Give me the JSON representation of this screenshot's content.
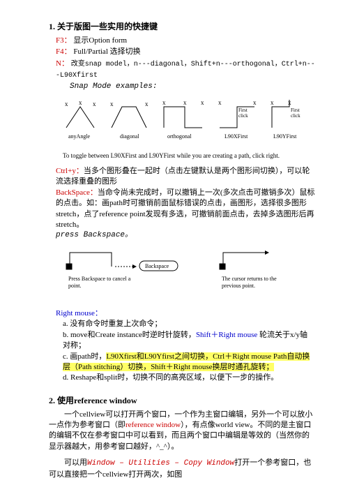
{
  "section1": {
    "number": "1.",
    "title": "关于版图一些实用的快捷键",
    "f3_key": "F3：",
    "f3_text": "显示Option form",
    "f4_key": "F4：",
    "f4_text": "Full/Partial 选择切换",
    "n_key": "N：",
    "n_text": "改变snap model，n---diagonal，Shift+n---orthogonal，Ctrl+n---L90Xfirst",
    "snap_examples": "Snap Mode examples:",
    "svg_labels": {
      "anyangle": "anyAngle",
      "diagonal": "diagonal",
      "orthogonal": "orthogonal",
      "l90x": "L90XFirst",
      "l90y": "L90YFirst",
      "firstclick": "First click"
    },
    "toggle_caption": "To toggle between L90XFirst and L90YFirst while you are creating a path, click right.",
    "ctrly_key": "Ctrl+y：",
    "ctrly_text": "当多个图形叠在一起时（点击左键默认是两个图形间切换），可以轮流选择重叠的图形",
    "backspace_key": "BackSpace：",
    "backspace_text1": "当命令尚未完成时，可以撤销上一次(多次点击可撤销多次）鼠标的点击。如：画path时可撤销前面鼠标错误的点击，画图形，选择很多图形stretch，点了reference point发现有多选，可撤销前面点击，去掉多选图形后再stretch。",
    "press_backspace": "press Backspace。",
    "svg2_label1": "Backspace",
    "svg2_caption1": "Press Backspace to cancel a point.",
    "svg2_caption2": "The cursor returns to the previous point.",
    "rightmouse_key": "Right mouse：",
    "item_a": "a. 没有命令时重复上次命令；",
    "item_b_1": "b. move和Create instance时逆时针旋转，",
    "item_b_2": "Shift＋Right mouse",
    "item_b_3": "  轮流关于x/y轴对称；",
    "item_c_1": "c. 画path时，",
    "item_c_2": "L90Xfirst和L90Yfirst之间切换，Ctrl＋Right mouse  Path自动换层（Path stitching）切换，Shift＋Right mouse换层时通孔旋转；",
    "item_d": "d. Reshape和split时，切换不同的高亮区域，以便下一步的操作。"
  },
  "section2": {
    "number": "2.",
    "title": "使用reference window",
    "p1_1": "一个cellview可以打开两个窗口，一个作为主窗口编辑，另外一个可以放小一点作为参考窗口（即",
    "p1_2": "reference window",
    "p1_3": "），有点像world view。不同的是主窗口的编辑不仅在参考窗口中可以看到，而且两个窗口中编辑是等效的（当然你的显示器越大，用参考窗口越好，^_^）。",
    "p2_1": "可以用",
    "p2_2": "Window – Utilities – Copy Window",
    "p2_3": "打开一个参考窗口，也可以直接把一个cellview打开两次，如图"
  }
}
